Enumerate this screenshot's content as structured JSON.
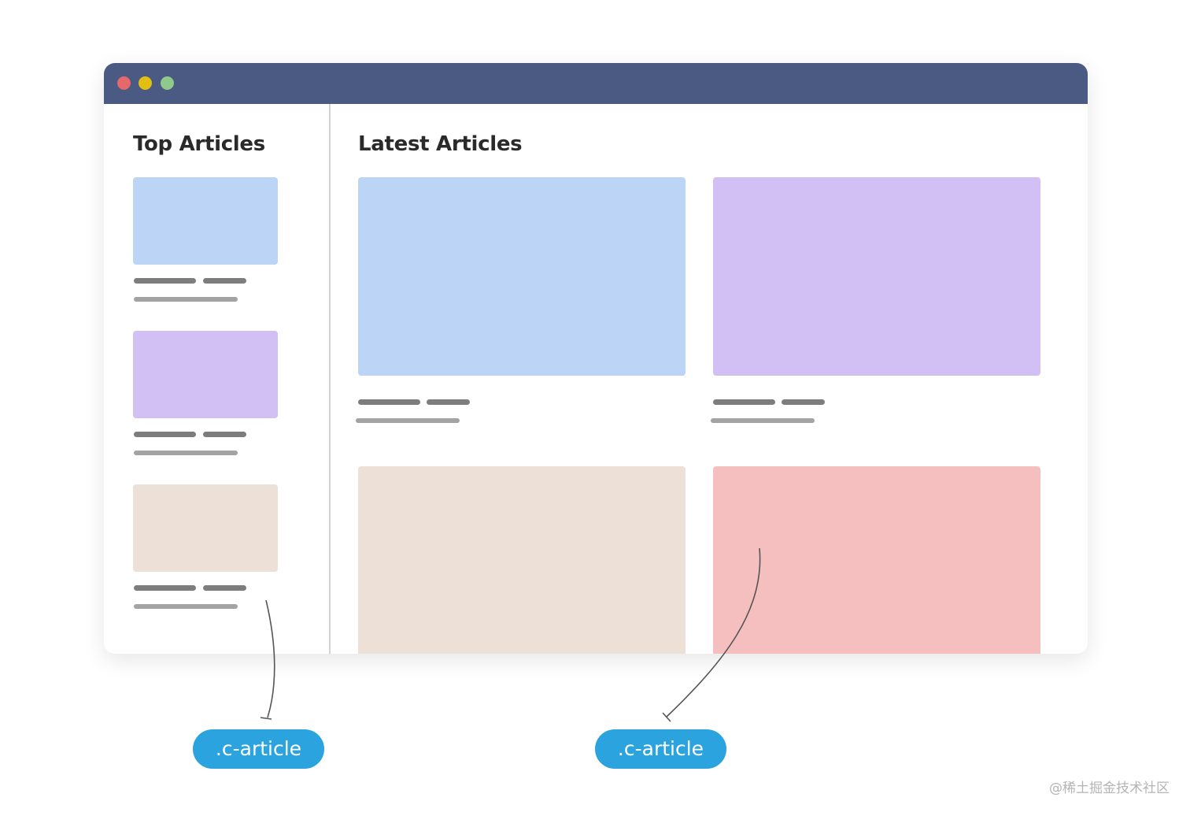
{
  "window": {
    "titlebar_color": "#4b5a82",
    "traffic_lights": [
      "#e5686a",
      "#e3bf13",
      "#8fc98c"
    ]
  },
  "sidebar": {
    "title": "Top Articles",
    "articles": [
      {
        "thumb_color": "#bcd4f5"
      },
      {
        "thumb_color": "#d2bff4"
      },
      {
        "thumb_color": "#ede0d7"
      }
    ]
  },
  "main": {
    "title": "Latest Articles",
    "articles": [
      {
        "thumb_color": "#bcd4f5"
      },
      {
        "thumb_color": "#d2bff4"
      },
      {
        "thumb_color": "#ede0d7"
      },
      {
        "thumb_color": "#f5bfbf"
      }
    ]
  },
  "annotations": {
    "labels": [
      ".c-article",
      ".c-article"
    ],
    "label_color": "#2aa3df"
  },
  "watermark": "@稀土掘金技术社区"
}
